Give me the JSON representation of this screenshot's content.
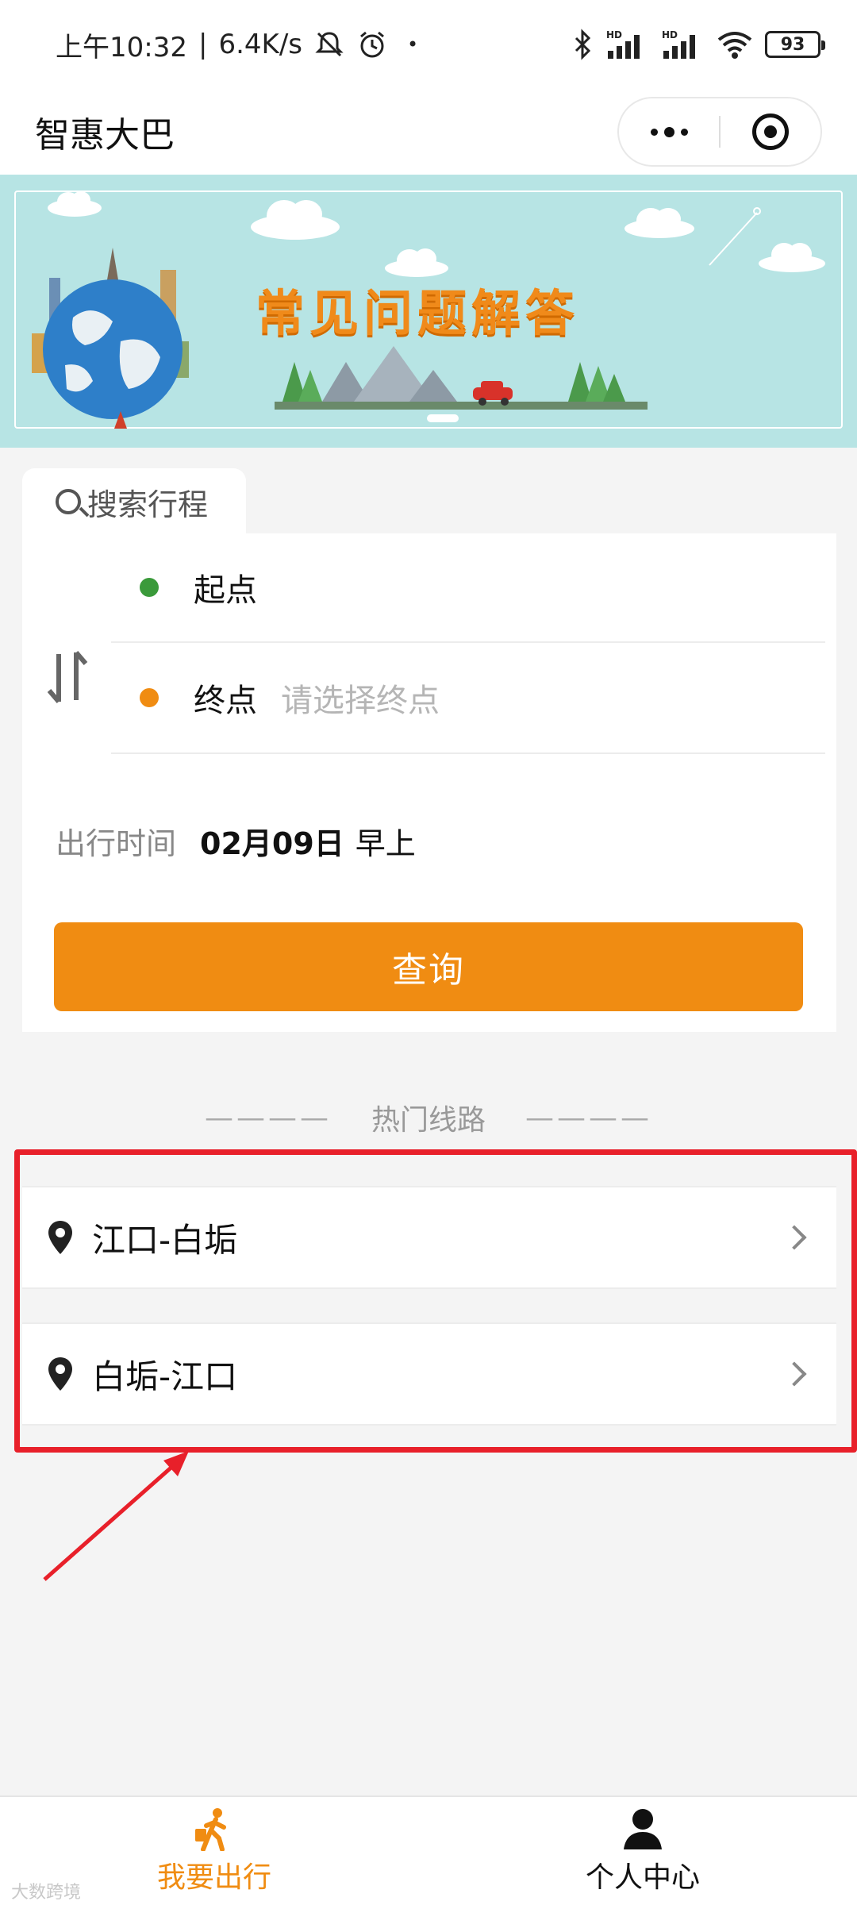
{
  "status_bar": {
    "time": "上午10:32",
    "network_speed": "6.4K/s",
    "signal_label": "HD",
    "battery": "93",
    "icons": [
      "mute-bell-icon",
      "alarm-icon",
      "bluetooth-icon",
      "hd-signal-icon",
      "wifi-icon",
      "battery-icon"
    ]
  },
  "header": {
    "title": "智惠大巴"
  },
  "banner": {
    "title": "常见问题解答"
  },
  "search": {
    "tab_label": "搜索行程",
    "start_label": "起点",
    "start_value": "",
    "end_label": "终点",
    "end_placeholder": "请选择终点",
    "time_label": "出行时间",
    "time_value": "02月09日",
    "time_period": "早上",
    "query_button": "查询"
  },
  "hot_routes": {
    "header": "热门线路",
    "dash": "————",
    "items": [
      {
        "label": "江口-白垢"
      },
      {
        "label": "白垢-江口"
      }
    ]
  },
  "tab_bar": {
    "items": [
      {
        "label": "我要出行",
        "icon": "walking-person-icon",
        "active": true
      },
      {
        "label": "个人中心",
        "icon": "user-icon",
        "active": false
      }
    ]
  },
  "watermark": "大数跨境",
  "colors": {
    "accent": "#f08c12",
    "start_dot": "#3a9a3a",
    "end_dot": "#f08c12",
    "annotation": "#e8202a",
    "banner_bg": "#b7e4e4"
  }
}
